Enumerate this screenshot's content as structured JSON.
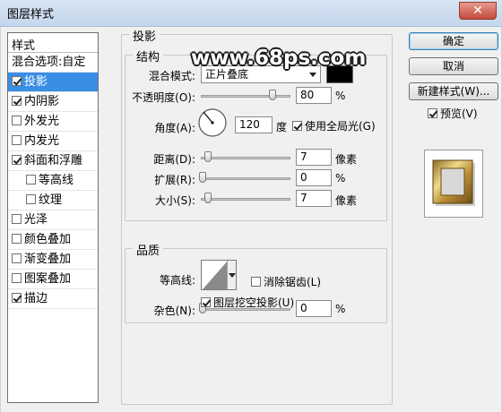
{
  "window": {
    "title": "图层样式",
    "close_symbol": "✕"
  },
  "watermark": "www.68ps.com",
  "styles_panel": {
    "header": "样式",
    "items": [
      {
        "label": "混合选项:自定",
        "checkbox": false,
        "checked": false,
        "selected": false,
        "indent": false
      },
      {
        "label": "投影",
        "checkbox": true,
        "checked": true,
        "selected": true,
        "indent": false
      },
      {
        "label": "内阴影",
        "checkbox": true,
        "checked": true,
        "selected": false,
        "indent": false
      },
      {
        "label": "外发光",
        "checkbox": true,
        "checked": false,
        "selected": false,
        "indent": false
      },
      {
        "label": "内发光",
        "checkbox": true,
        "checked": false,
        "selected": false,
        "indent": false
      },
      {
        "label": "斜面和浮雕",
        "checkbox": true,
        "checked": true,
        "selected": false,
        "indent": false
      },
      {
        "label": "等高线",
        "checkbox": true,
        "checked": false,
        "selected": false,
        "indent": true
      },
      {
        "label": "纹理",
        "checkbox": true,
        "checked": false,
        "selected": false,
        "indent": true
      },
      {
        "label": "光泽",
        "checkbox": true,
        "checked": false,
        "selected": false,
        "indent": false
      },
      {
        "label": "颜色叠加",
        "checkbox": true,
        "checked": false,
        "selected": false,
        "indent": false
      },
      {
        "label": "渐变叠加",
        "checkbox": true,
        "checked": false,
        "selected": false,
        "indent": false
      },
      {
        "label": "图案叠加",
        "checkbox": true,
        "checked": false,
        "selected": false,
        "indent": false
      },
      {
        "label": "描边",
        "checkbox": true,
        "checked": true,
        "selected": false,
        "indent": false
      }
    ]
  },
  "drop_shadow": {
    "title": "投影",
    "structure": {
      "title": "结构",
      "blend_mode_label": "混合模式:",
      "blend_mode_value": "正片叠底",
      "shadow_color": "#000000",
      "opacity_label": "不透明度(O):",
      "opacity_value": "80",
      "opacity_unit": "%",
      "angle_label": "角度(A):",
      "angle_value": "120",
      "angle_unit": "度",
      "global_light_label": "使用全局光(G)",
      "global_light_checked": true,
      "distance_label": "距离(D):",
      "distance_value": "7",
      "distance_unit": "像素",
      "spread_label": "扩展(R):",
      "spread_value": "0",
      "spread_unit": "%",
      "size_label": "大小(S):",
      "size_value": "7",
      "size_unit": "像素"
    },
    "quality": {
      "title": "品质",
      "contour_label": "等高线:",
      "antialias_label": "消除锯齿(L)",
      "antialias_checked": false,
      "noise_label": "杂色(N):",
      "noise_value": "0",
      "noise_unit": "%"
    },
    "knockout_label": "图层挖空投影(U)",
    "knockout_checked": true
  },
  "buttons": {
    "ok": "确定",
    "cancel": "取消",
    "new_style": "新建样式(W)...",
    "preview_label": "预览(V)",
    "preview_checked": true
  },
  "colors": {
    "selection": "#3a8ee6",
    "gold": "#c9a64a"
  }
}
